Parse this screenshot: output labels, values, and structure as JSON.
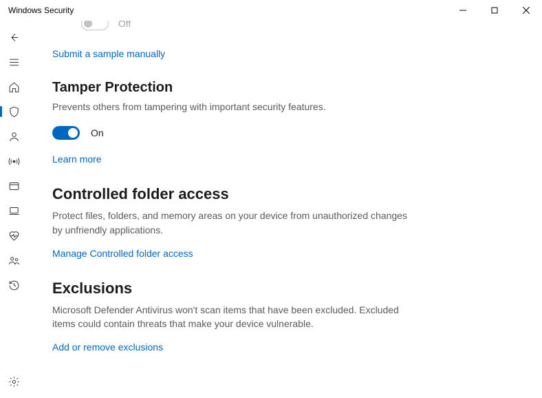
{
  "titlebar": {
    "title": "Windows Security"
  },
  "prev_toggle": {
    "label": "Off"
  },
  "links": {
    "submit_sample": "Submit a sample manually",
    "learn_more": "Learn more",
    "manage_cfa": "Manage Controlled folder access",
    "exclusions": "Add or remove exclusions"
  },
  "tamper": {
    "heading": "Tamper Protection",
    "desc": "Prevents others from tampering with important security features.",
    "toggle_label": "On"
  },
  "cfa": {
    "heading": "Controlled folder access",
    "desc": "Protect files, folders, and memory areas on your device from unauthorized changes by unfriendly applications."
  },
  "exclusions": {
    "heading": "Exclusions",
    "desc": "Microsoft Defender Antivirus won't scan items that have been excluded. Excluded items could contain threats that make your device vulnerable."
  }
}
